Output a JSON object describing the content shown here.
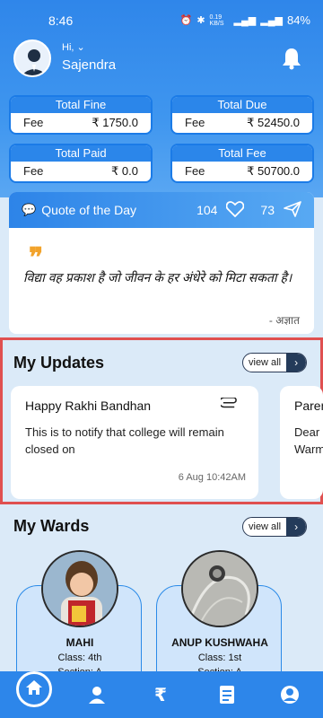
{
  "status_bar": {
    "time": "8:46",
    "network_speed": "0.19 KB/S",
    "battery": "84%"
  },
  "header": {
    "greeting": "Hi,",
    "username": "Sajendra"
  },
  "fees": [
    {
      "title": "Total Fine",
      "label": "Fee",
      "amount": "₹ 1750.0"
    },
    {
      "title": "Total Due",
      "label": "Fee",
      "amount": "₹ 52450.0"
    },
    {
      "title": "Total Paid",
      "label": "Fee",
      "amount": "₹ 0.0"
    },
    {
      "title": "Total Fee",
      "label": "Fee",
      "amount": "₹ 50700.0"
    }
  ],
  "quote": {
    "heading": "Quote of the Day",
    "likes": "104",
    "shares": "73",
    "mark": "❞",
    "text": "विद्या वह प्रकाश है जो जीवन के हर अंधेरे को मिटा सकता है।",
    "author": "- अज्ञात"
  },
  "updates": {
    "title": "My Updates",
    "view_all": "view all",
    "items": [
      {
        "title": "Happy Rakhi Bandhan",
        "body": "This is to notify that college will remain closed on",
        "time": "6 Aug 10:42AM"
      },
      {
        "title": "Paren",
        "body": "Dear Warm",
        "time": ""
      }
    ]
  },
  "wards": {
    "title": "My Wards",
    "view_all": "view all",
    "items": [
      {
        "name": "MAHI",
        "class": "Class:  4th",
        "section": "Section:  A"
      },
      {
        "name": "ANUP KUSHWAHA",
        "class": "Class:  1st",
        "section": "Section:  A"
      }
    ]
  },
  "colors": {
    "primary": "#2d86ea",
    "highlight_border": "#e05050",
    "quote_mark": "#f2a32b"
  },
  "nav": [
    "home-icon",
    "student-icon",
    "rupee-icon",
    "receipt-icon",
    "profile-icon"
  ]
}
